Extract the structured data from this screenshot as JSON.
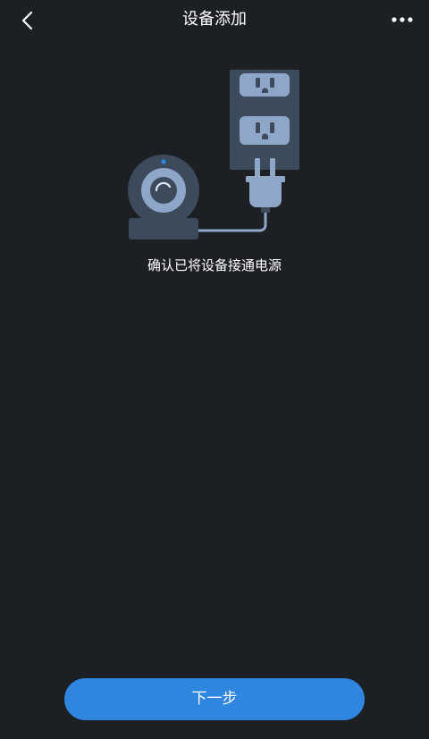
{
  "header": {
    "title": "设备添加",
    "back_icon": "chevron-left-icon",
    "more_icon": "more-dots-icon"
  },
  "illustration": {
    "description_icon": "camera-plug-outlet-illustration"
  },
  "main": {
    "instruction": "确认已将设备接通电源"
  },
  "footer": {
    "next_label": "下一步"
  },
  "colors": {
    "background": "#1c1f24",
    "accent": "#2f86de",
    "illustration_light": "#8ea6c8",
    "illustration_dark": "#3d4a5c"
  }
}
